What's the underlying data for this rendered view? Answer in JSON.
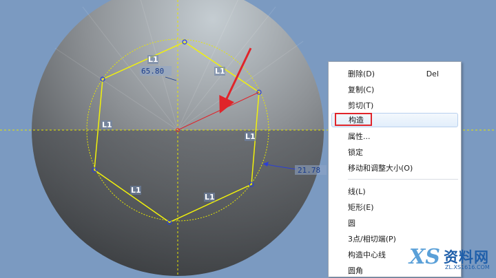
{
  "sketch": {
    "dimension_diameter": "65.80",
    "dimension_radius": "21.78",
    "constraint_label": "L1"
  },
  "context_menu": {
    "items": [
      {
        "label": "删除(D)",
        "shortcut": "Del"
      },
      {
        "label": "复制(C)",
        "shortcut": ""
      },
      {
        "label": "剪切(T)",
        "shortcut": ""
      },
      {
        "label": "构造",
        "shortcut": "",
        "highlighted": true
      },
      {
        "label": "属性...",
        "shortcut": ""
      },
      {
        "label": "锁定",
        "shortcut": ""
      },
      {
        "label": "移动和调整大小(O)",
        "shortcut": ""
      },
      {
        "label": "线(L)",
        "shortcut": ""
      },
      {
        "label": "矩形(E)",
        "shortcut": ""
      },
      {
        "label": "圆",
        "shortcut": ""
      },
      {
        "label": "3点/相切端(P)",
        "shortcut": ""
      },
      {
        "label": "构造中心线",
        "shortcut": ""
      },
      {
        "label": "圆角",
        "shortcut": ""
      }
    ]
  },
  "watermark": {
    "logo": "XS",
    "title": "资料网",
    "url": "ZL.XS1616.COM"
  },
  "colors": {
    "background": "#7b9ac1",
    "sketch_line": "#f2f20a",
    "axis": "#e8e800",
    "annotation_red": "#e0242a",
    "menu_highlight": "#e2eefb"
  }
}
